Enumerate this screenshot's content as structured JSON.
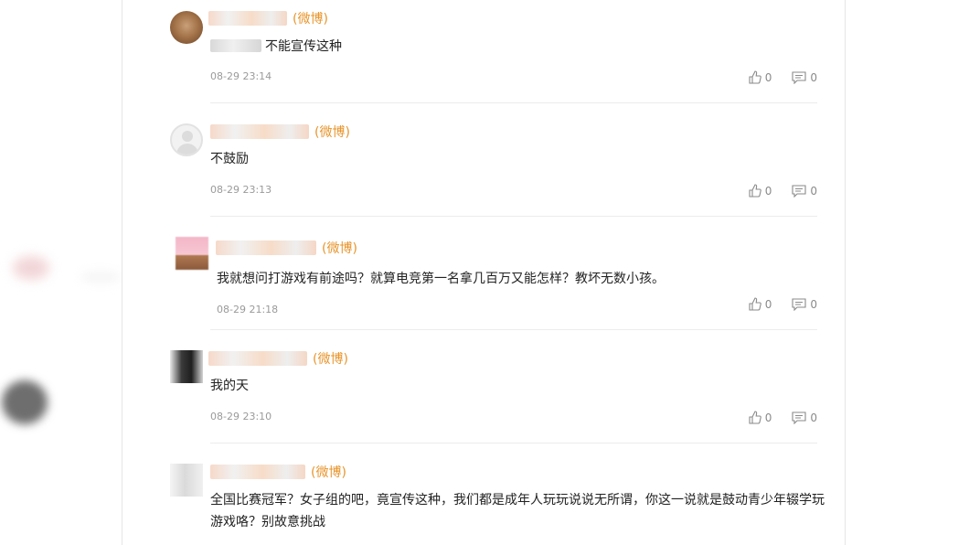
{
  "source_label": "(微博)",
  "comments": [
    {
      "text": "不能宣传这种",
      "time": "08-29 23:14",
      "likes": "0",
      "replies": "0"
    },
    {
      "text": "不鼓励",
      "time": "08-29 23:13",
      "likes": "0",
      "replies": "0"
    },
    {
      "text": "我就想问打游戏有前途吗？就算电竞第一名拿几百万又能怎样？教坏无数小孩。",
      "time": "08-29 21:18",
      "likes": "0",
      "replies": "0"
    },
    {
      "text": "我的天",
      "time": "08-29 23:10",
      "likes": "0",
      "replies": "0"
    },
    {
      "text": "全国比赛冠军？女子组的吧，竟宣传这种，我们都是成年人玩玩说说无所谓，你这一说就是鼓动青少年辍学玩游戏咯？别故意挑战"
    }
  ],
  "colors": {
    "source_accent": "#e8952c",
    "time_text": "#9a9a9a",
    "divider": "#ececec"
  },
  "icons": {
    "like": "thumbs-up-icon",
    "reply": "comment-bubble-icon"
  }
}
